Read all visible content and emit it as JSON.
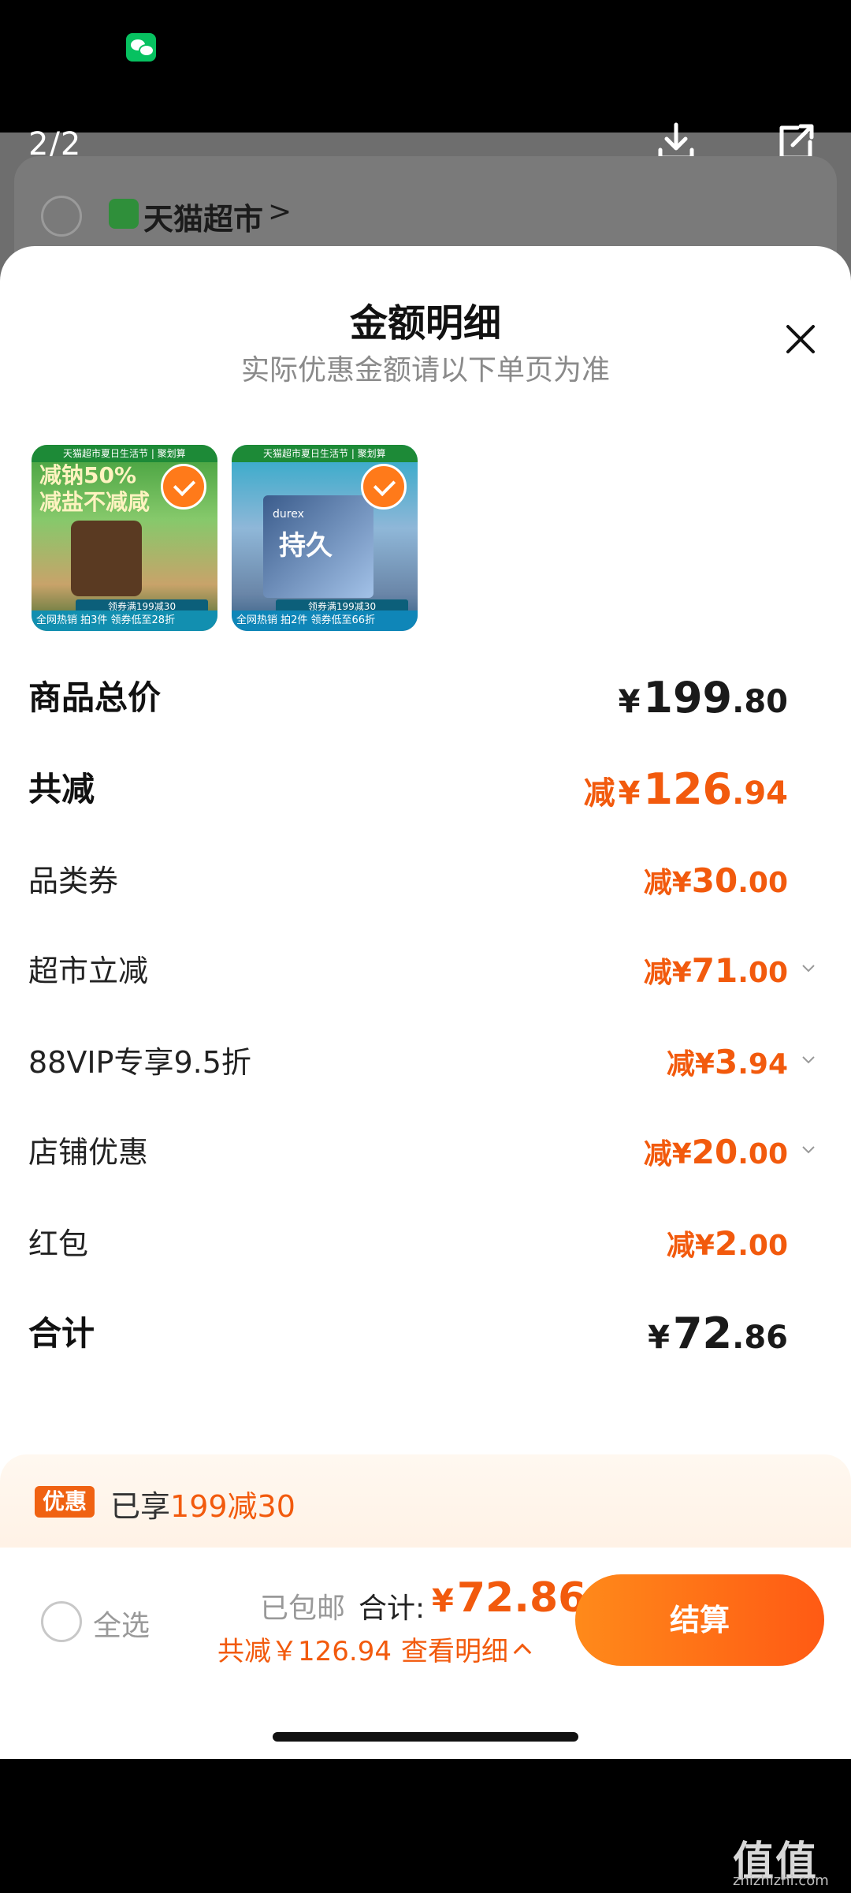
{
  "colors": {
    "accent": "#f25a0d",
    "checkout_gradient_start": "#ff8a1a",
    "checkout_gradient_end": "#ff5a14",
    "tag_bg": "#f06212"
  },
  "background": {
    "counter": "2/2",
    "shop_name": "天猫超市",
    "shop_arrow": ">"
  },
  "sheet": {
    "title": "金额明细",
    "subtitle": "实际优惠金额请以下单页为准"
  },
  "products": [
    {
      "banner": "天猫超市夏日生活节 | 聚划算",
      "headline_1": "减钠50%",
      "headline_2": "减盐不减咸",
      "coupon": "领券满199减30",
      "footer": "全网热销 拍3件 领券低至28折",
      "selected": true
    },
    {
      "banner": "天猫超市夏日生活节 | 聚划算",
      "box_brand": "durex",
      "box_title": "持久",
      "coupon": "领券满199减30",
      "footer": "全网热销 拍2件 领券低至66折",
      "selected": true
    }
  ],
  "lines": [
    {
      "label": "商品总价",
      "prefix": "",
      "cur": "¥",
      "int": "199",
      "dec": ".80",
      "style": "total",
      "chevron": false
    },
    {
      "label": "共减",
      "prefix": "减",
      "cur": "¥",
      "int": "126",
      "dec": ".94",
      "style": "bigorange",
      "chevron": false
    },
    {
      "label": "品类券",
      "prefix": "减",
      "cur": "¥",
      "int": "30",
      "dec": ".00",
      "style": "orange",
      "chevron": false
    },
    {
      "label": "超市立减",
      "prefix": "减",
      "cur": "¥",
      "int": "71",
      "dec": ".00",
      "style": "orange",
      "chevron": true
    },
    {
      "label": "88VIP专享9.5折",
      "prefix": "减",
      "cur": "¥",
      "int": "3",
      "dec": ".94",
      "style": "orange",
      "chevron": true
    },
    {
      "label": "店铺优惠",
      "prefix": "减",
      "cur": "¥",
      "int": "20",
      "dec": ".00",
      "style": "orange",
      "chevron": true
    },
    {
      "label": "红包",
      "prefix": "减",
      "cur": "¥",
      "int": "2",
      "dec": ".00",
      "style": "orange",
      "chevron": false
    },
    {
      "label": "合计",
      "prefix": "",
      "cur": "¥",
      "int": "72",
      "dec": ".86",
      "style": "total",
      "chevron": false
    }
  ],
  "coupon_strip": {
    "tag": "优惠",
    "text_prefix": "已享",
    "text_highlight": "199减30"
  },
  "bottom": {
    "select_all": "全选",
    "free_shipping": "已包邮",
    "total_label": "合计:",
    "total_cur": "¥",
    "total_value": "72.86",
    "saved": "共减￥126.94",
    "detail": "查看明细",
    "checkout": "结算"
  },
  "watermark": {
    "logo": "值值值",
    "url": "zhizhizhi.com"
  }
}
